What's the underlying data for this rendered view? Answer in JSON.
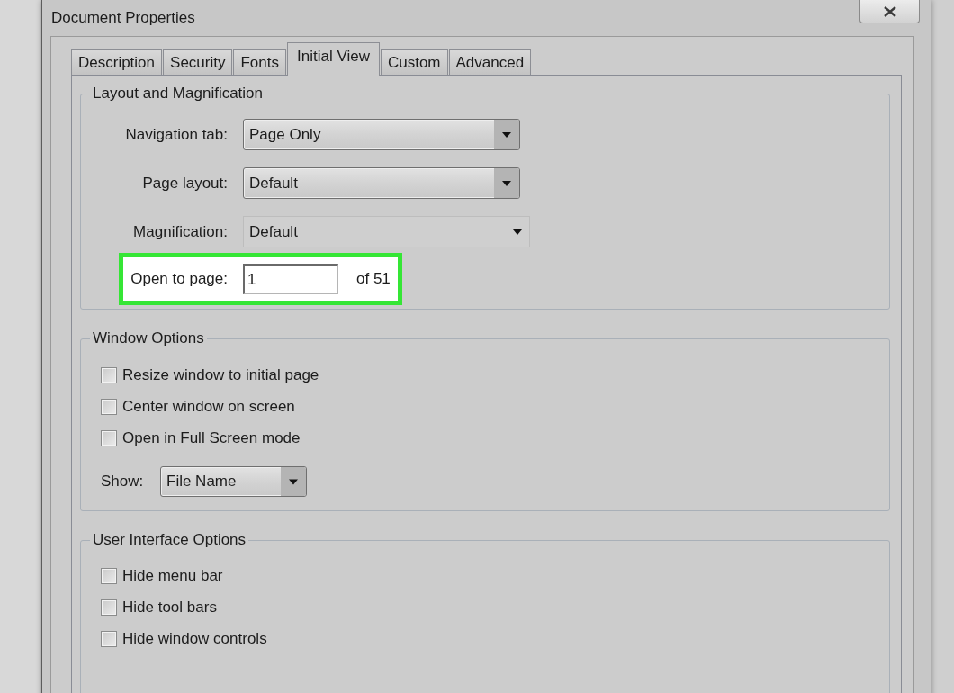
{
  "window": {
    "title": "Document Properties"
  },
  "tabs": [
    {
      "label": "Description",
      "selected": false
    },
    {
      "label": "Security",
      "selected": false
    },
    {
      "label": "Fonts",
      "selected": false
    },
    {
      "label": "Initial View",
      "selected": true
    },
    {
      "label": "Custom",
      "selected": false
    },
    {
      "label": "Advanced",
      "selected": false
    }
  ],
  "layout_and_magnification": {
    "title": "Layout and Magnification",
    "fields": [
      {
        "label": "Navigation tab:",
        "value": "Page Only",
        "kind": "dropdown"
      },
      {
        "label": "Page layout:",
        "value": "Default",
        "kind": "dropdown"
      },
      {
        "label": "Magnification:",
        "value": "Default",
        "kind": "combo"
      }
    ],
    "open_to_page": {
      "label": "Open to page:",
      "value": "1",
      "total": "of 51",
      "highlighted": true
    }
  },
  "window_options": {
    "title": "Window Options",
    "options": [
      {
        "label": "Resize window to initial page",
        "checked": false
      },
      {
        "label": "Center window on screen",
        "checked": false
      },
      {
        "label": "Open in Full Screen mode",
        "checked": false
      }
    ],
    "show": {
      "label": "Show:",
      "value": "File Name",
      "kind": "dropdown"
    }
  },
  "user_interface_options": {
    "title": "User Interface Options",
    "options": [
      {
        "label": "Hide menu bar",
        "checked": false
      },
      {
        "label": "Hide tool bars",
        "checked": false
      },
      {
        "label": "Hide window controls",
        "checked": false
      }
    ]
  }
}
